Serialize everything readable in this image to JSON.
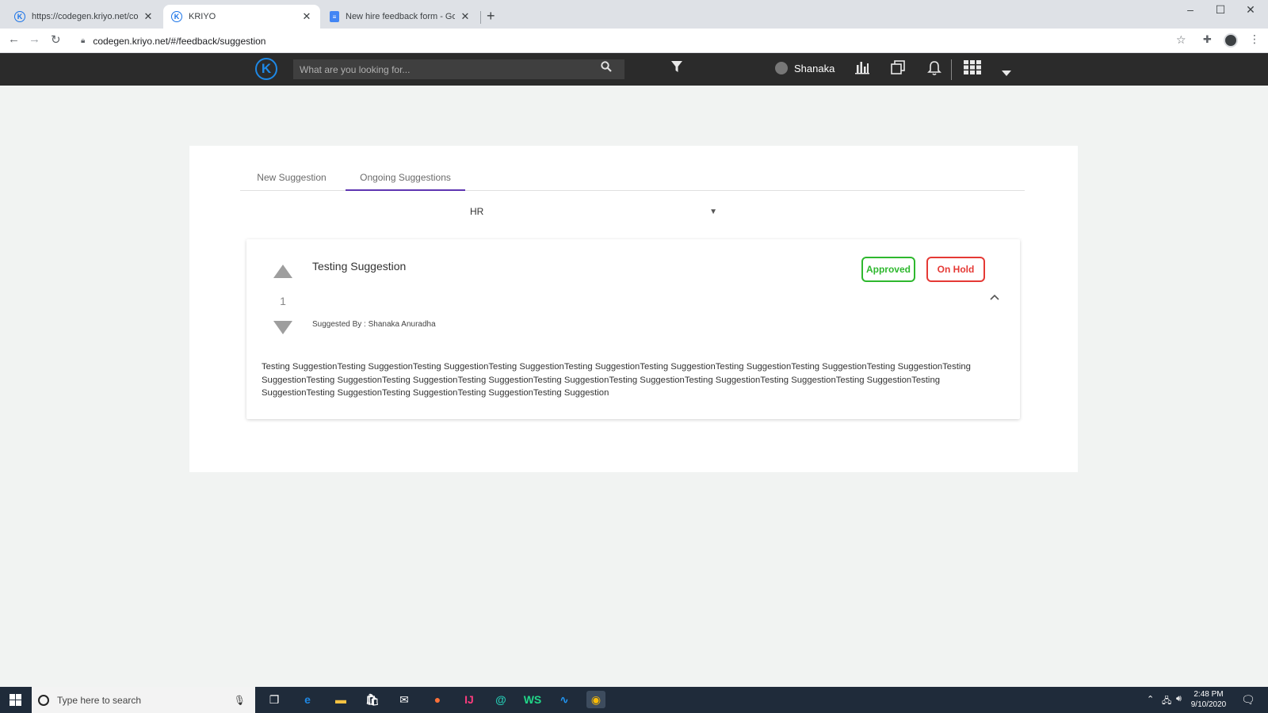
{
  "browser": {
    "tabs": [
      {
        "label": "https://codegen.kriyo.net/codeg",
        "active": false
      },
      {
        "label": "KRIYO",
        "active": true
      },
      {
        "label": "New hire feedback form - Googl",
        "active": false
      }
    ],
    "url": "codegen.kriyo.net/#/feedback/suggestion"
  },
  "header": {
    "logo_letter": "K",
    "search_placeholder": "What are you looking for...",
    "user_name": "Shanaka"
  },
  "content": {
    "tabs": [
      "New Suggestion",
      "Ongoing Suggestions"
    ],
    "selected_tab": "Ongoing Suggestions",
    "department": "HR",
    "suggestion": {
      "title": "Testing Suggestion",
      "votes": "1",
      "suggested_by": "Suggested By : Shanaka Anuradha",
      "status_approved": "Approved",
      "status_hold": "On Hold",
      "description": "Testing SuggestionTesting SuggestionTesting SuggestionTesting SuggestionTesting SuggestionTesting SuggestionTesting SuggestionTesting SuggestionTesting SuggestionTesting SuggestionTesting SuggestionTesting SuggestionTesting SuggestionTesting SuggestionTesting SuggestionTesting SuggestionTesting SuggestionTesting SuggestionTesting SuggestionTesting SuggestionTesting SuggestionTesting SuggestionTesting Suggestion"
    }
  },
  "taskbar": {
    "search_placeholder": "Type here to search",
    "time": "2:48 PM",
    "date": "9/10/2020"
  },
  "colors": {
    "approved": "#2eb82e",
    "on_hold": "#e53935",
    "tab_indicator": "#5e35b1",
    "logo": "#1e88e5"
  }
}
